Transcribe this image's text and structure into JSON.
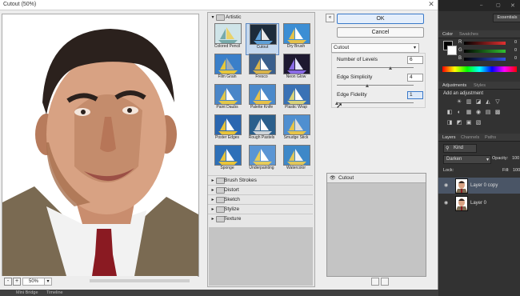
{
  "dialog": {
    "title": "Cutout (50%)",
    "close_icon": "close-icon",
    "zoom_minus": "-",
    "zoom_plus": "+",
    "zoom_value": "50%"
  },
  "gallery": {
    "category_open": "Artistic",
    "filters": [
      {
        "label": "Colored Pencil"
      },
      {
        "label": "Cutout",
        "selected": true
      },
      {
        "label": "Dry Brush"
      },
      {
        "label": "Film Grain"
      },
      {
        "label": "Fresco"
      },
      {
        "label": "Neon Glow"
      },
      {
        "label": "Paint Daubs"
      },
      {
        "label": "Palette Knife"
      },
      {
        "label": "Plastic Wrap"
      },
      {
        "label": "Poster Edges"
      },
      {
        "label": "Rough Pastels"
      },
      {
        "label": "Smudge Stick"
      },
      {
        "label": "Sponge"
      },
      {
        "label": "Underpainting"
      },
      {
        "label": "Watercolor"
      }
    ],
    "categories_closed": [
      "Brush Strokes",
      "Distort",
      "Sketch",
      "Stylize",
      "Texture"
    ]
  },
  "settings": {
    "ok_label": "OK",
    "cancel_label": "Cancel",
    "filter_selected": "Cutout",
    "params": [
      {
        "label": "Number of Levels",
        "value": "6",
        "position": 0.7
      },
      {
        "label": "Edge Simplicity",
        "value": "4",
        "position": 0.4
      },
      {
        "label": "Edge Fidelity",
        "value": "1",
        "position": 0.0
      }
    ]
  },
  "effects": {
    "layers": [
      {
        "label": "Cutout"
      }
    ]
  },
  "ps": {
    "essentials_label": "Essentials",
    "color_tabs": [
      "Color",
      "Swatches"
    ],
    "channels": [
      {
        "label": "R",
        "value": "0",
        "color": "#e03030"
      },
      {
        "label": "G",
        "value": "0",
        "color": "#30c030"
      },
      {
        "label": "B",
        "value": "0",
        "color": "#3050e0"
      }
    ],
    "adj_tabs": [
      "Adjustments",
      "Styles"
    ],
    "adj_title": "Add an adjustment",
    "layer_tabs": [
      "Layers",
      "Channels",
      "Paths"
    ],
    "kind_label": "Kind",
    "blend_mode": "Darken",
    "opacity_label": "Opacity:",
    "opacity_value": "100",
    "lock_label": "Lock:",
    "fill_label": "Fill:",
    "fill_value": "100",
    "layers": [
      {
        "name": "Layer 0 copy"
      },
      {
        "name": "Layer 0"
      }
    ]
  },
  "bottom_tabs": [
    "Mini Bridge",
    "Timeline"
  ]
}
